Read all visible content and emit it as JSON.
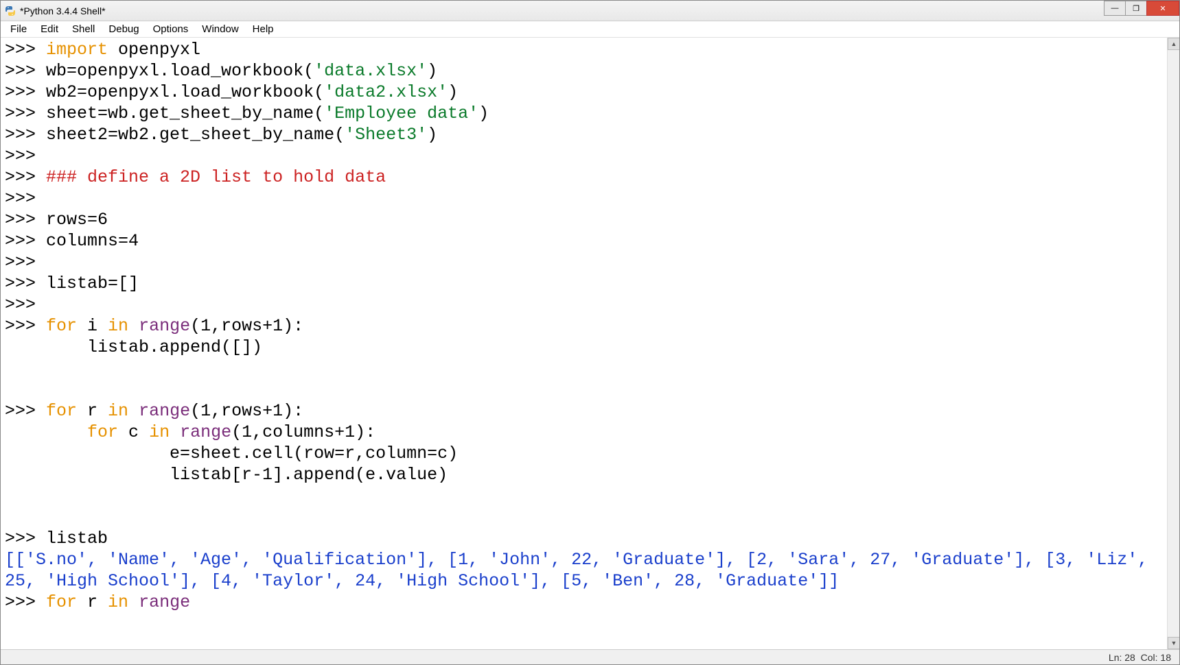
{
  "title": "*Python 3.4.4 Shell*",
  "menu": {
    "file": "File",
    "edit": "Edit",
    "shell": "Shell",
    "debug": "Debug",
    "options": "Options",
    "window": "Window",
    "help": "Help"
  },
  "prompt": ">>> ",
  "lines": {
    "l01_kw": "import",
    "l01_rest": " openpyxl",
    "l02": "wb=openpyxl.load_workbook(",
    "l02_str": "'data.xlsx'",
    "l02_end": ")",
    "l03": "wb2=openpyxl.load_workbook(",
    "l03_str": "'data2.xlsx'",
    "l03_end": ")",
    "l04": "sheet=wb.get_sheet_by_name(",
    "l04_str": "'Employee data'",
    "l04_end": ")",
    "l05": "sheet2=wb2.get_sheet_by_name(",
    "l05_str": "'Sheet3'",
    "l05_end": ")",
    "l07_cmt": "### define a 2D list to hold data",
    "l09": "rows=6",
    "l10": "columns=4",
    "l12": "listab=[]",
    "l14_for": "for",
    "l14_mid": " i ",
    "l14_in": "in",
    "l14_sp": " ",
    "l14_range": "range",
    "l14_args": "(1,rows+1):",
    "l15_indent": "        listab.append([])",
    "l17_for": "for",
    "l17_mid": " r ",
    "l17_in": "in",
    "l17_sp": " ",
    "l17_range": "range",
    "l17_args": "(1,rows+1):",
    "l18_indent": "        ",
    "l18_for": "for",
    "l18_mid": " c ",
    "l18_in": "in",
    "l18_sp": " ",
    "l18_range": "range",
    "l18_args": "(1,columns+1):",
    "l19": "                e=sheet.cell(row=r,column=c)",
    "l20": "                listab[r-1].append(e.value)",
    "l22": "listab",
    "l23_out": "[['S.no', 'Name', 'Age', 'Qualification'], [1, 'John', 22, 'Graduate'], [2, 'Sara', 27, 'Graduate'], [3, 'Liz', 25, 'High School'], [4, 'Taylor', 24, 'High School'], [5, 'Ben', 28, 'Graduate']]",
    "l24_for": "for",
    "l24_mid": " r ",
    "l24_in": "in",
    "l24_sp": " ",
    "l24_range": "range"
  },
  "status": {
    "ln": "Ln: 28",
    "col": "Col: 18"
  },
  "win": {
    "min": "—",
    "max": "❐",
    "close": "✕"
  }
}
